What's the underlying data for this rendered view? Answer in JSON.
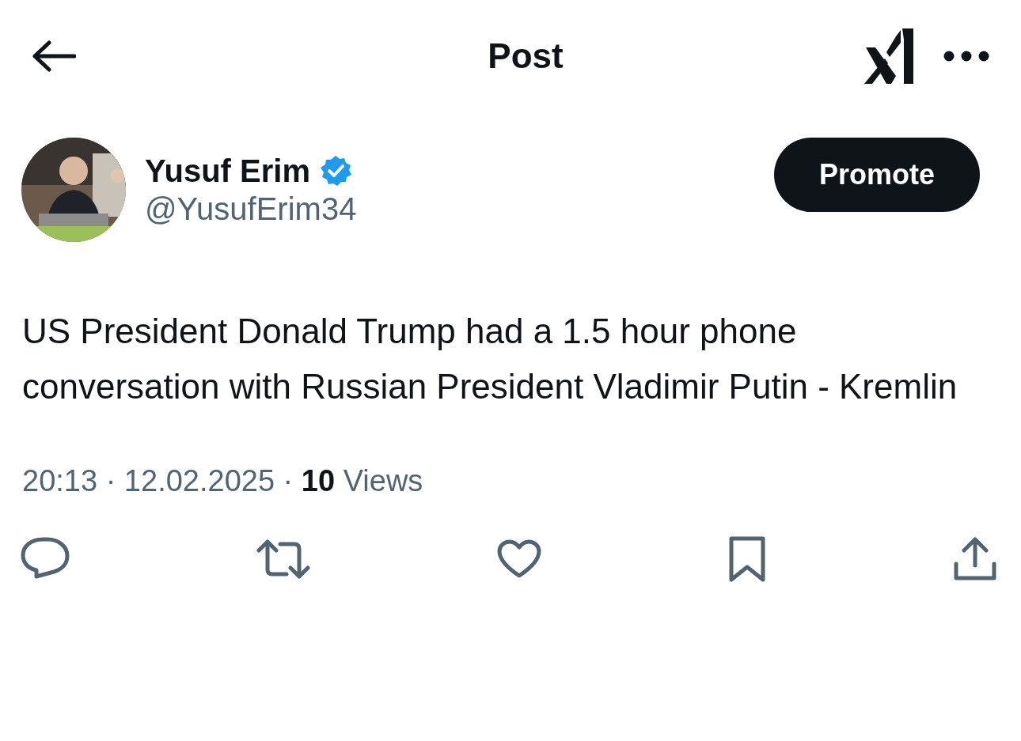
{
  "header": {
    "title": "Post"
  },
  "author": {
    "name": "Yusuf Erim",
    "handle": "@YusufErim34",
    "verified": true
  },
  "promote_button": {
    "label": "Promote"
  },
  "post": {
    "text": "US President Donald Trump had a 1.5 hour phone conversation with Russian President Vladimir Putin - Kremlin",
    "meta": "20:13 · 12.02.2025 · **10** Views"
  }
}
